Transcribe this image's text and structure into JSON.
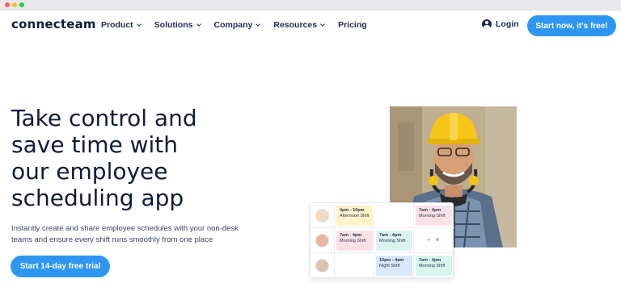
{
  "nav": {
    "logo": "connecteam",
    "menu": [
      {
        "label": "Product"
      },
      {
        "label": "Solutions"
      },
      {
        "label": "Company"
      },
      {
        "label": "Resources"
      },
      {
        "label": "Pricing"
      }
    ],
    "login_label": "Login",
    "cta_label": "Start now, it's free!"
  },
  "hero": {
    "title_lines": [
      "Take control and",
      "save time with",
      "our employee",
      "scheduling app"
    ],
    "subtitle_lines": [
      "Instantly create and share employee schedules with your non-desk",
      "teams and ensure every shift runs smoothly from one place"
    ],
    "cta_label": "Start 14-day free trial"
  },
  "schedule": {
    "rows": [
      {
        "cells": [
          {
            "time": "4pm - 10pm",
            "shift": "Afternoon Shift",
            "color": "yellow"
          },
          null,
          {
            "time": "7am - 4pm",
            "shift": "Morning Shift",
            "color": "pink"
          }
        ]
      },
      {
        "cells": [
          {
            "time": "7am - 4pm",
            "shift": "Morning Shift",
            "color": "pink"
          },
          {
            "time": "7am - 4pm",
            "shift": "Morning Shift",
            "color": "teal"
          },
          null
        ],
        "plus": "+"
      },
      {
        "cells": [
          null,
          {
            "time": "10pm - 4am",
            "shift": "Night Shift",
            "color": "blue"
          },
          {
            "time": "7am - 4pm",
            "shift": "Morning Shift",
            "color": "teal"
          }
        ]
      }
    ]
  },
  "colors": {
    "brand_blue": "#2e96f0",
    "text_dark": "#0f1a3c"
  }
}
